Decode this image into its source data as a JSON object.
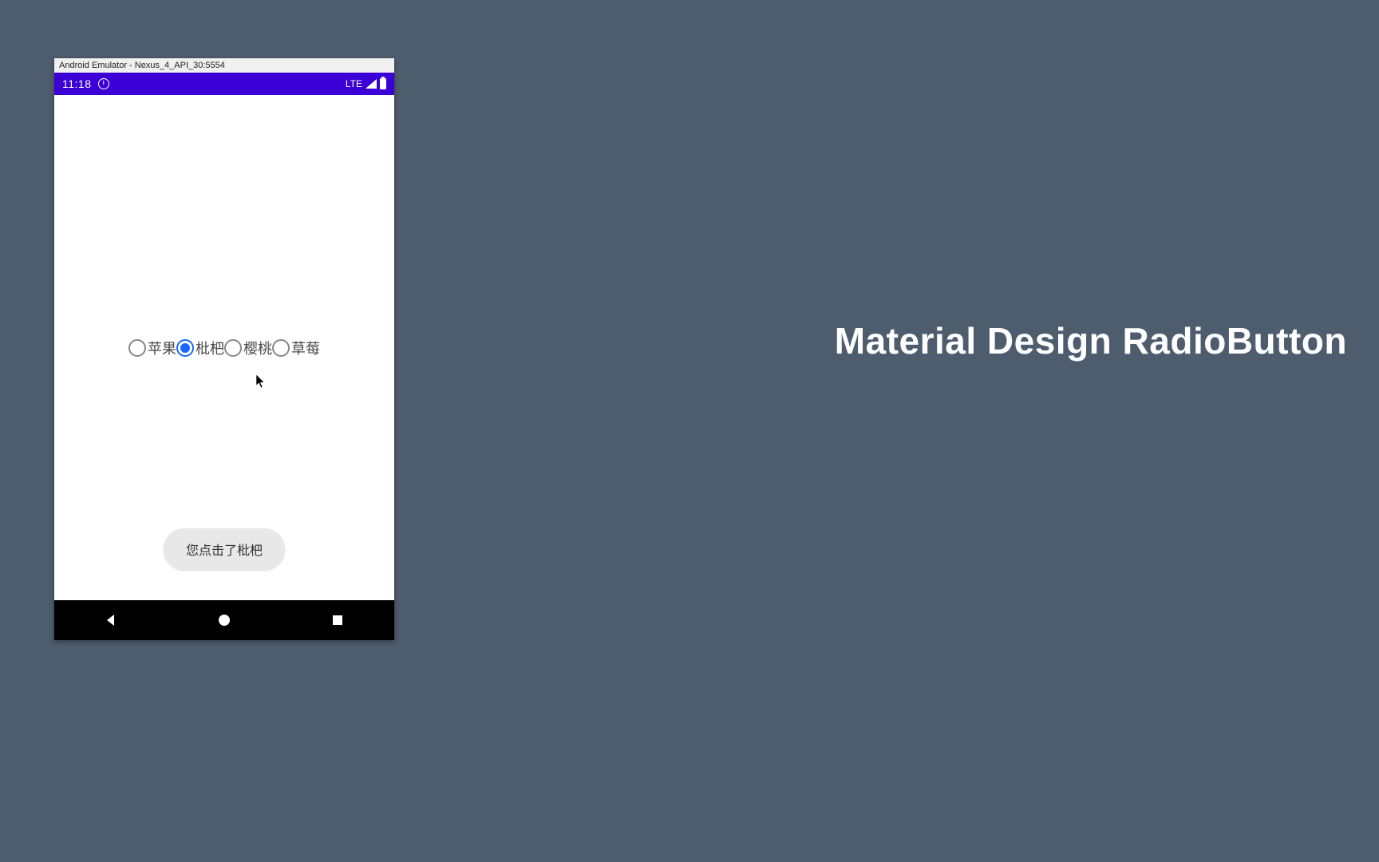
{
  "emulator": {
    "titlebar": "Android Emulator - Nexus_4_API_30:5554"
  },
  "statusbar": {
    "time": "11:18",
    "network_label": "LTE"
  },
  "radios": {
    "selected_index": 1,
    "items": [
      {
        "label": "苹果"
      },
      {
        "label": "枇杷"
      },
      {
        "label": "樱桃"
      },
      {
        "label": "草莓"
      }
    ]
  },
  "toast": {
    "text": "您点击了枇杷"
  },
  "slide": {
    "title": "Material Design RadioButton"
  },
  "colors": {
    "background": "#4e5d6e",
    "statusbar_bg": "#3a00d6",
    "accent": "#1867ff"
  }
}
